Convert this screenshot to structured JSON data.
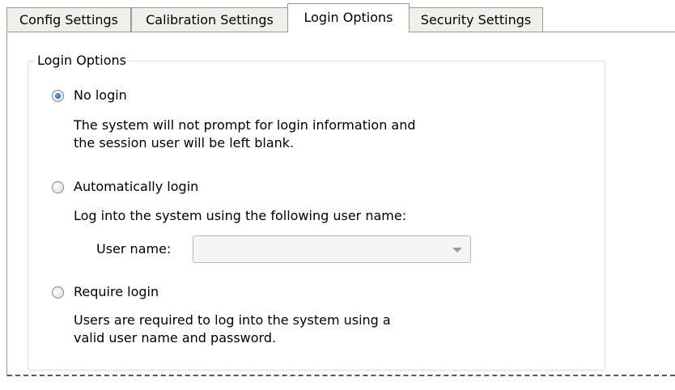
{
  "tabs": [
    {
      "label": "Config Settings",
      "active": false
    },
    {
      "label": "Calibration Settings",
      "active": false
    },
    {
      "label": "Login Options",
      "active": true
    },
    {
      "label": "Security Settings",
      "active": false
    }
  ],
  "group": {
    "title": "Login Options",
    "options": [
      {
        "label": "No login",
        "checked": true,
        "description_lines": [
          "The system will not prompt for login information and",
          "the session user will be left blank."
        ]
      },
      {
        "label": "Automatically login",
        "checked": false,
        "description_lines": [
          "Log into the system using the following user name:"
        ]
      },
      {
        "label": "Require login",
        "checked": false,
        "description_lines": [
          "Users are required to log into the system using a",
          "valid user name and password."
        ]
      }
    ],
    "username": {
      "label": "User name:",
      "value": "",
      "enabled": false
    }
  },
  "colors": {
    "tab_border": "#919b9c",
    "tab_inactive_bg": "#f0f0ea",
    "radio_selected": "#1f62c3",
    "groupbox_border": "#d5dfe5"
  },
  "icons": {
    "dropdown": "chevron-down-icon"
  }
}
